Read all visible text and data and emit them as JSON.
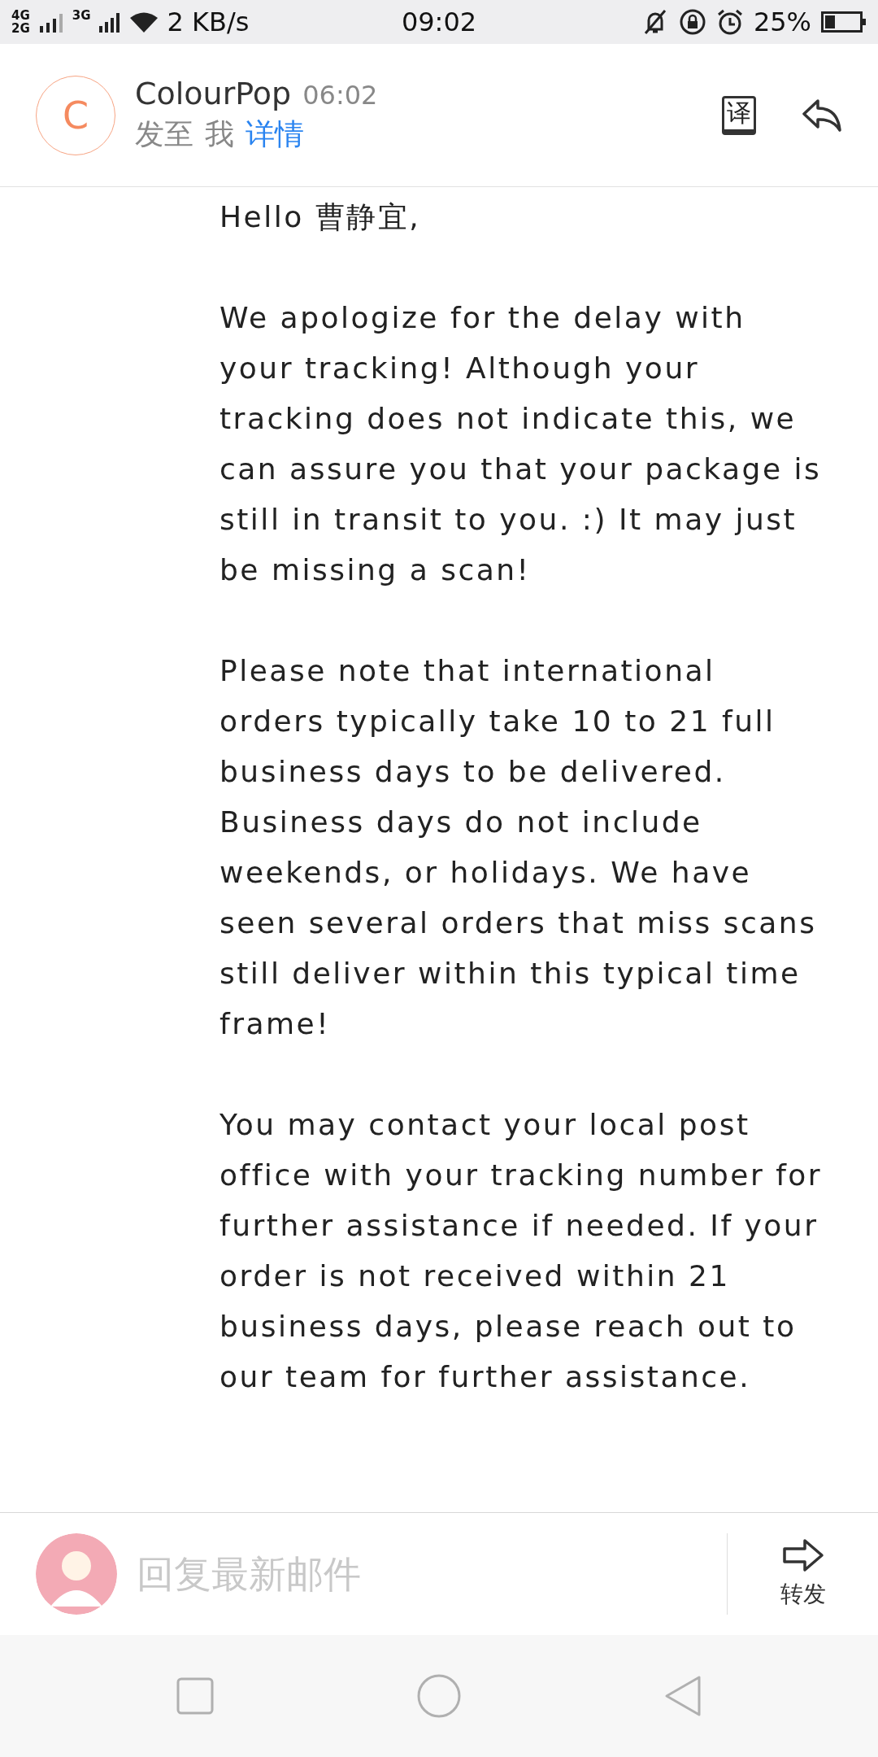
{
  "status_bar": {
    "network_a": "4G",
    "network_b": "2G",
    "network_c": "3G",
    "speed": "2 KB/s",
    "time": "09:02",
    "battery": "25%"
  },
  "header": {
    "avatar_letter": "C",
    "sender": "ColourPop",
    "time": "06:02",
    "to_label": "发至",
    "recipient": "我",
    "details_link": "详情",
    "translate_glyph": "译"
  },
  "body": {
    "paragraphs": [
      "Hello 曹静宜,",
      "We apologize for the delay with your tracking! Although your tracking does not indicate this, we can assure you that your package is still in transit to you. :) It may just be missing a scan!",
      "Please note that international orders typically take 10 to 21 full business days to be delivered. Business days do not include weekends, or holidays. We have seen several orders that miss scans still deliver within this typical time frame!",
      "You may contact your local post office with your tracking number for further assistance if needed. If your order is not received within 21 business days, please reach out to our team for further assistance."
    ]
  },
  "reply_bar": {
    "placeholder": "回复最新邮件",
    "forward_label": "转发"
  }
}
